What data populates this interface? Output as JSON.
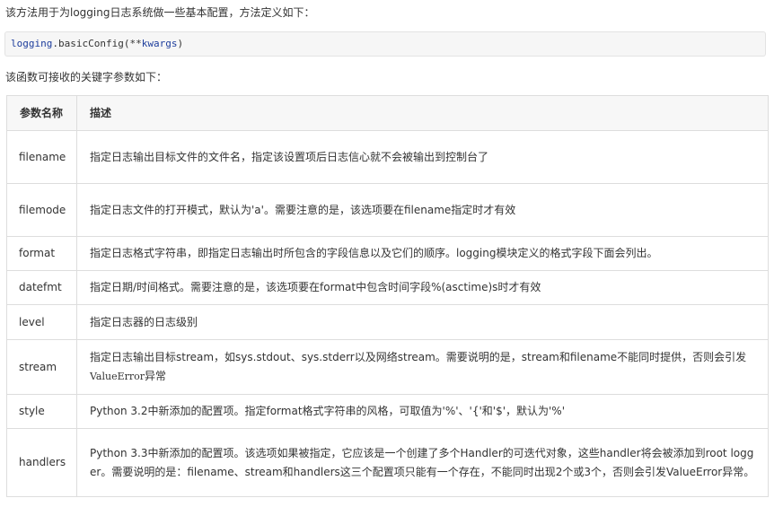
{
  "intro_text": "该方法用于为logging日志系统做一些基本配置，方法定义如下：",
  "code": {
    "module": "logging",
    "dot_func": ".basicConfig(",
    "stars": "**",
    "kwargs": "kwargs",
    "close": ")"
  },
  "intro2_text": "该函数可接收的关键字参数如下：",
  "table": {
    "headers": [
      "参数名称",
      "描述"
    ],
    "rows": [
      {
        "name": "filename",
        "desc": "指定日志输出目标文件的文件名，指定该设置项后日志信心就不会被输出到控制台了"
      },
      {
        "name": "filemode",
        "desc": "指定日志文件的打开模式，默认为'a'。需要注意的是，该选项要在filename指定时才有效"
      },
      {
        "name": "format",
        "desc": "指定日志格式字符串，即指定日志输出时所包含的字段信息以及它们的顺序。logging模块定义的格式字段下面会列出。"
      },
      {
        "name": "datefmt",
        "desc": "指定日期/时间格式。需要注意的是，该选项要在format中包含时间字段%(asctime)s时才有效"
      },
      {
        "name": "level",
        "desc": "指定日志器的日志级别"
      },
      {
        "name": "stream",
        "desc": "指定日志输出目标stream，如sys.stdout、sys.stderr以及网络stream。需要说明的是，stream和filename不能同时提供，否则会引发",
        "desc_code": "ValueError",
        "desc_tail": "异常"
      },
      {
        "name": "style",
        "desc": "Python 3.2中新添加的配置项。指定format格式字符串的风格，可取值为'%'、'{'和'$'，默认为'%'"
      },
      {
        "name": "handlers",
        "desc": "Python 3.3中新添加的配置项。该选项如果被指定，它应该是一个创建了多个Handler的可迭代对象，这些handler将会被添加到root logger。需要说明的是：filename、stream和handlers这三个配置项只能有一个存在，不能同时出现2个或3个，否则会引发ValueError异常。"
      }
    ]
  }
}
